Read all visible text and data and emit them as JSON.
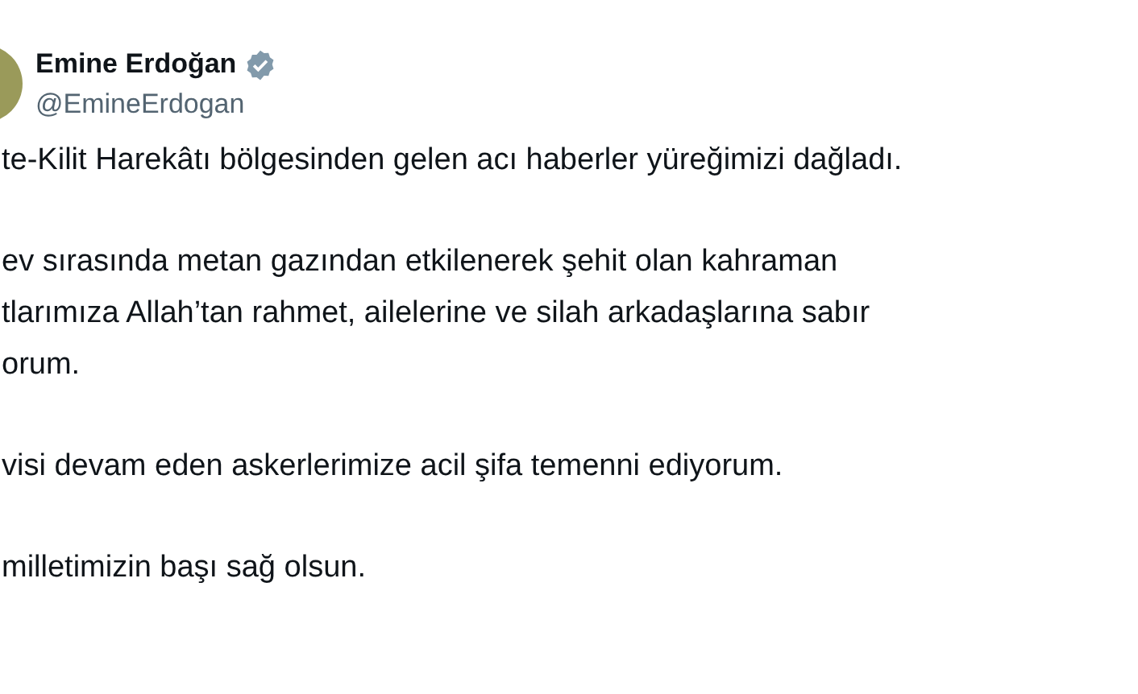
{
  "author": {
    "name": "Emine Erdoğan",
    "handle": "@EmineErdogan",
    "verified": true
  },
  "paragraphs": [
    {
      "lines": [
        "te-Kilit Harekâtı bölgesinden gelen acı haberler yüreğimizi dağladı."
      ]
    },
    {
      "lines": [
        "ev sırasında metan gazından etkilenerek şehit olan kahraman",
        "tlarımıza Allah’tan rahmet, ailelerine ve silah arkadaşlarına sabır",
        "orum."
      ]
    },
    {
      "lines": [
        "visi devam eden askerlerimize acil şifa temenni ediyorum."
      ]
    },
    {
      "lines": [
        "milletimizin başı sağ olsun."
      ]
    }
  ]
}
